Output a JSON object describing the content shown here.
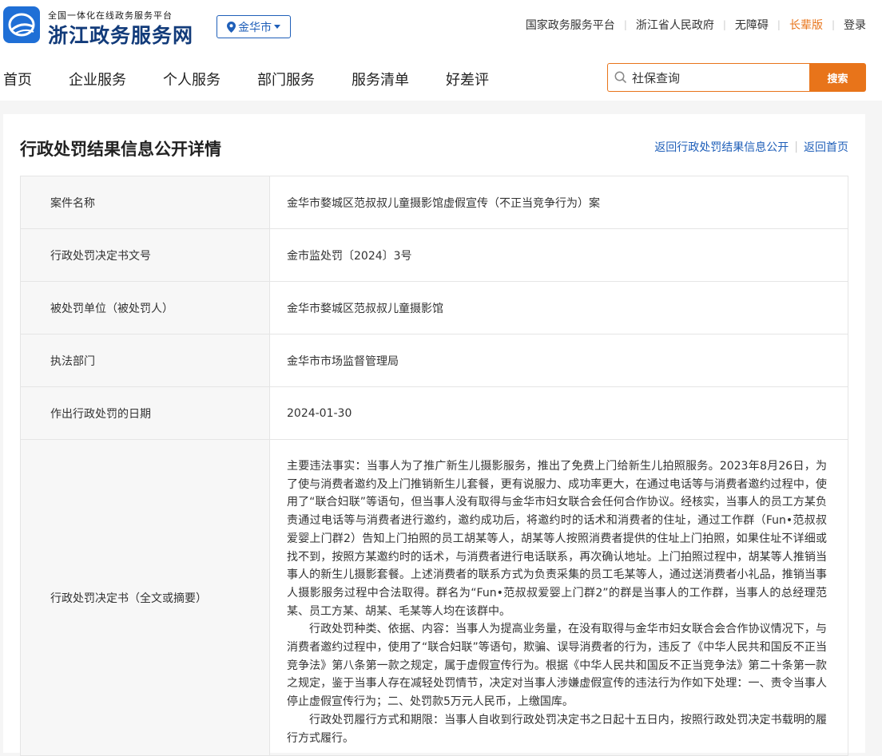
{
  "header": {
    "brand_sub": "全国一体化在线政务服务平台",
    "brand_main": "浙江政务服务网",
    "city": "金华市",
    "top_links": [
      "国家政务服务平台",
      "浙江省人民政府",
      "无障碍",
      "长辈版",
      "登录"
    ]
  },
  "nav": {
    "items": [
      "首页",
      "企业服务",
      "个人服务",
      "部门服务",
      "服务清单",
      "好差评"
    ]
  },
  "search": {
    "value": "社保查询",
    "button": "搜索"
  },
  "panel": {
    "title": "行政处罚结果信息公开详情",
    "link_back_list": "返回行政处罚结果信息公开",
    "link_home": "返回首页"
  },
  "rows": [
    {
      "label": "案件名称",
      "value": "金华市婺城区范叔叔儿童摄影馆虚假宣传（不正当竞争行为）案"
    },
    {
      "label": "行政处罚决定书文号",
      "value": "金市监处罚〔2024〕3号"
    },
    {
      "label": "被处罚单位（被处罚人）",
      "value": "金华市婺城区范叔叔儿童摄影馆"
    },
    {
      "label": "执法部门",
      "value": "金华市市场监督管理局"
    },
    {
      "label": "作出行政处罚的日期",
      "value": "2024-01-30"
    }
  ],
  "decision": {
    "label": "行政处罚决定书（全文或摘要）",
    "p1": "主要违法事实：当事人为了推广新生儿摄影服务，推出了免费上门给新生儿拍照服务。2023年8月26日，为了使与消费者邀约及上门推销新生儿套餐，更有说服力、成功率更大，在通过电话等与消费者邀约过程中，使用了“联合妇联”等语句，但当事人没有取得与金华市妇女联合会任何合作协议。经核实，当事人的员工方某负责通过电话等与消费者进行邀约，邀约成功后，将邀约时的话术和消费者的住址，通过工作群（Fun•范叔叔爱婴上门群2）告知上门拍照的员工胡某等人，胡某等人按照消费者提供的住址上门拍照，如果住址不详细或找不到，按照方某邀约时的话术，与消费者进行电话联系，再次确认地址。上门拍照过程中，胡某等人推销当事人的新生儿摄影套餐。上述消费者的联系方式为负责采集的员工毛某等人，通过送消费者小礼品，推销当事人摄影服务过程中合法取得。群名为“Fun•范叔叔爱婴上门群2”的群是当事人的工作群，当事人的总经理范某、员工方某、胡某、毛某等人均在该群中。",
    "p2": "行政处罚种类、依据、内容：当事人为提高业务量，在没有取得与金华市妇女联合会合作协议情况下，与消费者邀约过程中，使用了“联合妇联”等语句，欺骗、误导消费者的行为，违反了《中华人民共和国反不正当竞争法》第八条第一款之规定，属于虚假宣传行为。根据《中华人民共和国反不正当竞争法》第二十条第一款之规定，鉴于当事人存在减轻处罚情节，决定对当事人涉嫌虚假宣传的违法行为作如下处理：一、责令当事人停止虚假宣传行为；二、处罚款5万元人民币，上缴国库。",
    "p3": "行政处罚履行方式和期限：当事人自收到行政处罚决定书之日起十五日内，按照行政处罚决定书载明的履行方式履行。"
  },
  "colors": {
    "brand_blue": "#123b7a",
    "link_blue": "#1f5fb9",
    "accent_orange": "#e8741a"
  }
}
